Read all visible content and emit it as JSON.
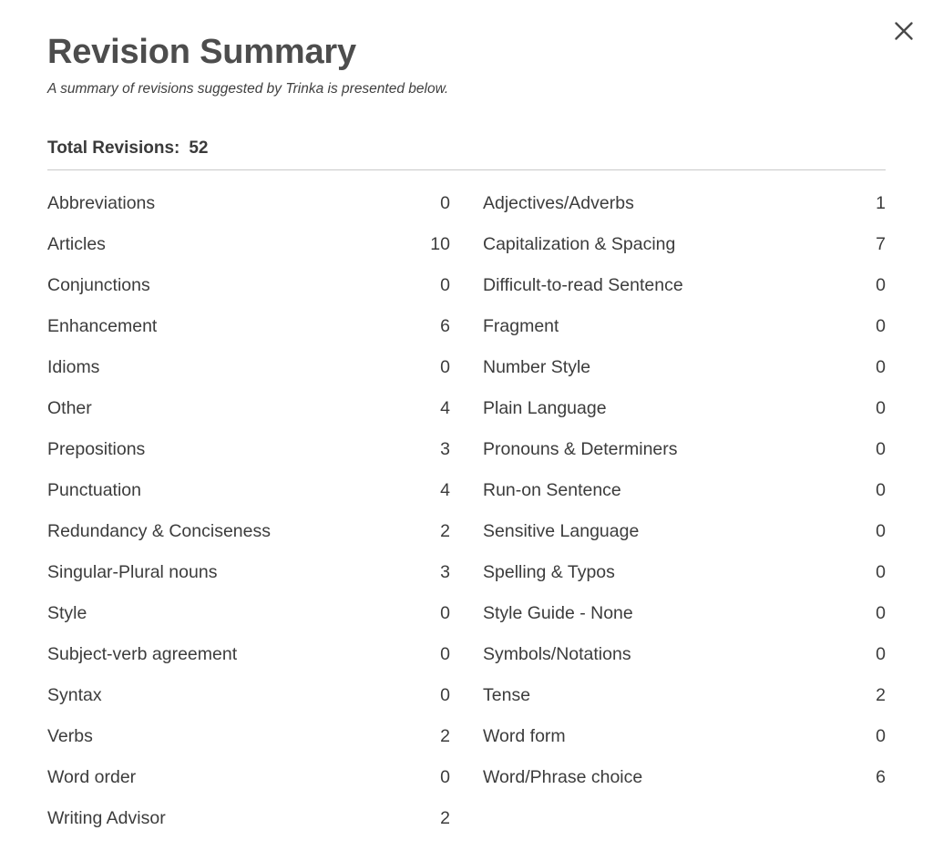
{
  "dialog": {
    "title": "Revision Summary",
    "subtitle": "A summary of revisions suggested by Trinka is presented below.",
    "close_label": "×",
    "total_label": "Total Revisions:",
    "total_value": "52",
    "accent_text_color": "#3c3c3c",
    "title_color": "#4d4d4d",
    "divider_color": "#c9c9c9"
  },
  "columns": {
    "left": [
      {
        "label": "Abbreviations",
        "value": "0"
      },
      {
        "label": "Articles",
        "value": "10"
      },
      {
        "label": "Conjunctions",
        "value": "0"
      },
      {
        "label": "Enhancement",
        "value": "6"
      },
      {
        "label": "Idioms",
        "value": "0"
      },
      {
        "label": "Other",
        "value": "4"
      },
      {
        "label": "Prepositions",
        "value": "3"
      },
      {
        "label": "Punctuation",
        "value": "4"
      },
      {
        "label": "Redundancy & Conciseness",
        "value": "2"
      },
      {
        "label": "Singular-Plural nouns",
        "value": "3"
      },
      {
        "label": "Style",
        "value": "0"
      },
      {
        "label": "Subject-verb agreement",
        "value": "0"
      },
      {
        "label": "Syntax",
        "value": "0"
      },
      {
        "label": "Verbs",
        "value": "2"
      },
      {
        "label": "Word order",
        "value": "0"
      },
      {
        "label": "Writing Advisor",
        "value": "2"
      }
    ],
    "right": [
      {
        "label": "Adjectives/Adverbs",
        "value": "1"
      },
      {
        "label": "Capitalization & Spacing",
        "value": "7"
      },
      {
        "label": "Difficult-to-read Sentence",
        "value": "0"
      },
      {
        "label": "Fragment",
        "value": "0"
      },
      {
        "label": "Number Style",
        "value": "0"
      },
      {
        "label": "Plain Language",
        "value": "0"
      },
      {
        "label": "Pronouns & Determiners",
        "value": "0"
      },
      {
        "label": "Run-on Sentence",
        "value": "0"
      },
      {
        "label": "Sensitive Language",
        "value": "0"
      },
      {
        "label": "Spelling & Typos",
        "value": "0"
      },
      {
        "label": "Style Guide - None",
        "value": "0"
      },
      {
        "label": "Symbols/Notations",
        "value": "0"
      },
      {
        "label": "Tense",
        "value": "2"
      },
      {
        "label": "Word form",
        "value": "0"
      },
      {
        "label": "Word/Phrase choice",
        "value": "6"
      }
    ]
  }
}
